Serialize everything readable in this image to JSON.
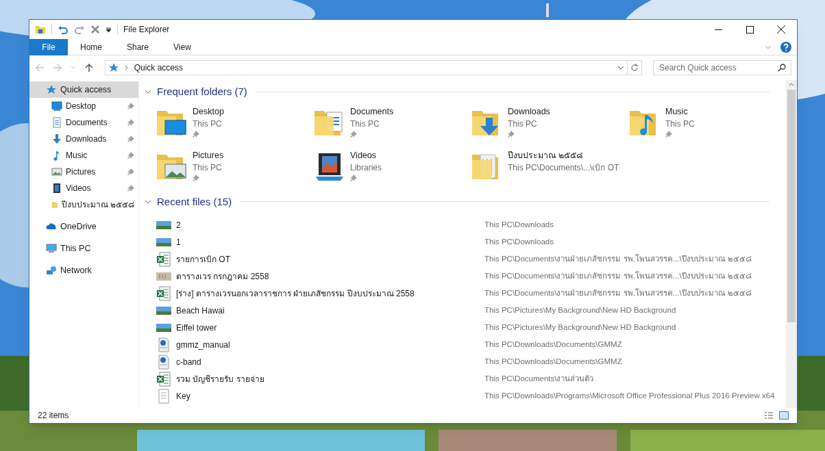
{
  "window": {
    "title": "File Explorer"
  },
  "ribbon_tabs": [
    {
      "label": "File",
      "selected": true
    },
    {
      "label": "Home",
      "selected": false
    },
    {
      "label": "Share",
      "selected": false
    },
    {
      "label": "View",
      "selected": false
    }
  ],
  "address": {
    "path": "Quick access"
  },
  "search": {
    "placeholder": "Search Quick access"
  },
  "nav": [
    {
      "label": "Quick access",
      "kind": "star",
      "selected": true,
      "children": [
        {
          "label": "Desktop",
          "kind": "desktop",
          "pinned": true
        },
        {
          "label": "Documents",
          "kind": "documents",
          "pinned": true
        },
        {
          "label": "Downloads",
          "kind": "downloads",
          "pinned": true
        },
        {
          "label": "Music",
          "kind": "music",
          "pinned": true
        },
        {
          "label": "Pictures",
          "kind": "pictures",
          "pinned": true
        },
        {
          "label": "Videos",
          "kind": "videos",
          "pinned": true
        },
        {
          "label": "ปีงบประมาณ ๒๕๕๘",
          "kind": "folder",
          "pinned": false
        }
      ]
    },
    {
      "label": "OneDrive",
      "kind": "cloud",
      "selected": false
    },
    {
      "label": "This PC",
      "kind": "pc",
      "selected": false
    },
    {
      "label": "Network",
      "kind": "network",
      "selected": false
    }
  ],
  "frequent": {
    "title": "Frequent folders (7)",
    "expanded": true,
    "items": [
      {
        "name": "Desktop",
        "location": "This PC",
        "kind": "desktop",
        "pinned": true
      },
      {
        "name": "Documents",
        "location": "This PC",
        "kind": "documents",
        "pinned": true
      },
      {
        "name": "Downloads",
        "location": "This PC",
        "kind": "downloads",
        "pinned": true
      },
      {
        "name": "Music",
        "location": "This PC",
        "kind": "music",
        "pinned": true
      },
      {
        "name": "Pictures",
        "location": "This PC",
        "kind": "pictures",
        "pinned": true
      },
      {
        "name": "Videos",
        "location": "Libraries",
        "kind": "videos",
        "pinned": true
      },
      {
        "name": "ปีงบประมาณ ๒๕๕๘",
        "location": "This PC\\Documents\\...\\เบิก OT",
        "kind": "sheet",
        "pinned": false
      }
    ]
  },
  "recent": {
    "title": "Recent files (15)",
    "expanded": true,
    "items": [
      {
        "name": "2",
        "path": "This PC\\Downloads"
      },
      {
        "name": "1",
        "path": "This PC\\Downloads"
      },
      {
        "name": "รายการเบิก OT",
        "path": "This PC\\Documents\\งานฝ่ายเภสัชกรรม รพ.โพนสวรรค...\\ปีงบประมาณ ๒๕๕๘",
        "kind": "excel"
      },
      {
        "name": "ตารางเวร กรกฎาคม 2558",
        "path": "This PC\\Documents\\งานฝ่ายเภสัชกรรม รพ.โพนสวรรค...\\ปีงบประมาณ ๒๕๕๘",
        "kind": "scan"
      },
      {
        "name": "[ร่าง] ตารางเวรนอกเวลาราชการ ฝ่ายเภสัชกรรม ปีงบประมาณ 2558",
        "path": "This PC\\Documents\\งานฝ่ายเภสัชกรรม รพ.โพนสวรรค...\\ปีงบประมาณ ๒๕๕๘",
        "kind": "excel"
      },
      {
        "name": "Beach Hawai",
        "path": "This PC\\Pictures\\My Background\\New HD Background"
      },
      {
        "name": "Eiffel tower",
        "path": "This PC\\Pictures\\My Background\\New HD Background"
      },
      {
        "name": "gmmz_manual",
        "path": "This PC\\Downloads\\Documents\\GMMZ",
        "kind": "pdf"
      },
      {
        "name": "c-band",
        "path": "This PC\\Downloads\\Documents\\GMMZ",
        "kind": "pdf"
      },
      {
        "name": "รวม บัญชีรายรับ รายจ่าย",
        "path": "This PC\\Documents\\งานส่วนตัว",
        "kind": "excel"
      },
      {
        "name": "Key",
        "path": "This PC\\Downloads\\Programs\\Microsoft Office Professional Plus 2016 Preview x64",
        "kind": "text"
      }
    ]
  },
  "status_bar": {
    "count": "22 items"
  }
}
